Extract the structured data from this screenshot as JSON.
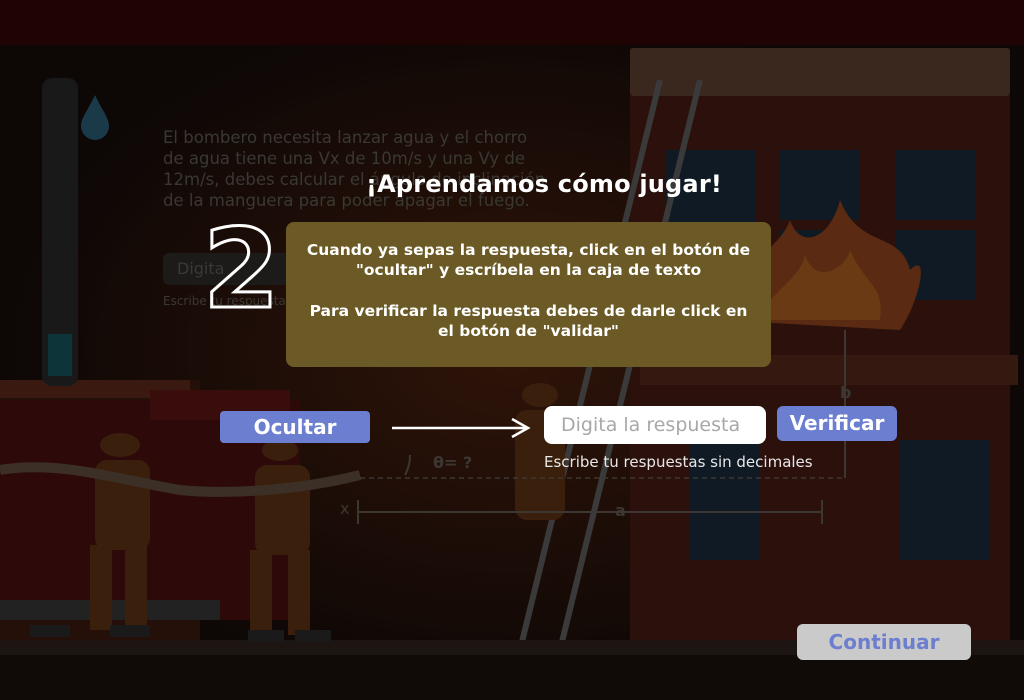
{
  "background": {
    "question": "El bombero necesita lanzar agua y el chorro de agua tiene una Vx de 10m/s  y una Vy de 12m/s, debes calcular el ángulo de inclinación de la manguera para poder apagar el fuego.",
    "input_text": "Digita",
    "hint": "Escribe tu respuestas sin decimales",
    "angle_label": "θ= ?",
    "label_a": "a",
    "label_b": "b",
    "label_x": "x"
  },
  "overlay": {
    "title": "¡Aprendamos cómo jugar!",
    "step_number": "2",
    "instruction_1": "Cuando ya sepas la respuesta, click en el botón de \"ocultar\" y escríbela en la caja de texto",
    "instruction_2": "Para verificar la respuesta debes de darle click en el botón de  \"validar\"",
    "hide_button": "Ocultar",
    "answer_placeholder": "Digita la respuesta",
    "verify_button": "Verificar",
    "hint": "Escribe tu respuestas sin decimales",
    "continue_button": "Continuar"
  },
  "colors": {
    "button": "#6c7ed0",
    "info_box": "#6b5a25",
    "top_bar": "#200303",
    "continue_bg": "#cacaca"
  }
}
